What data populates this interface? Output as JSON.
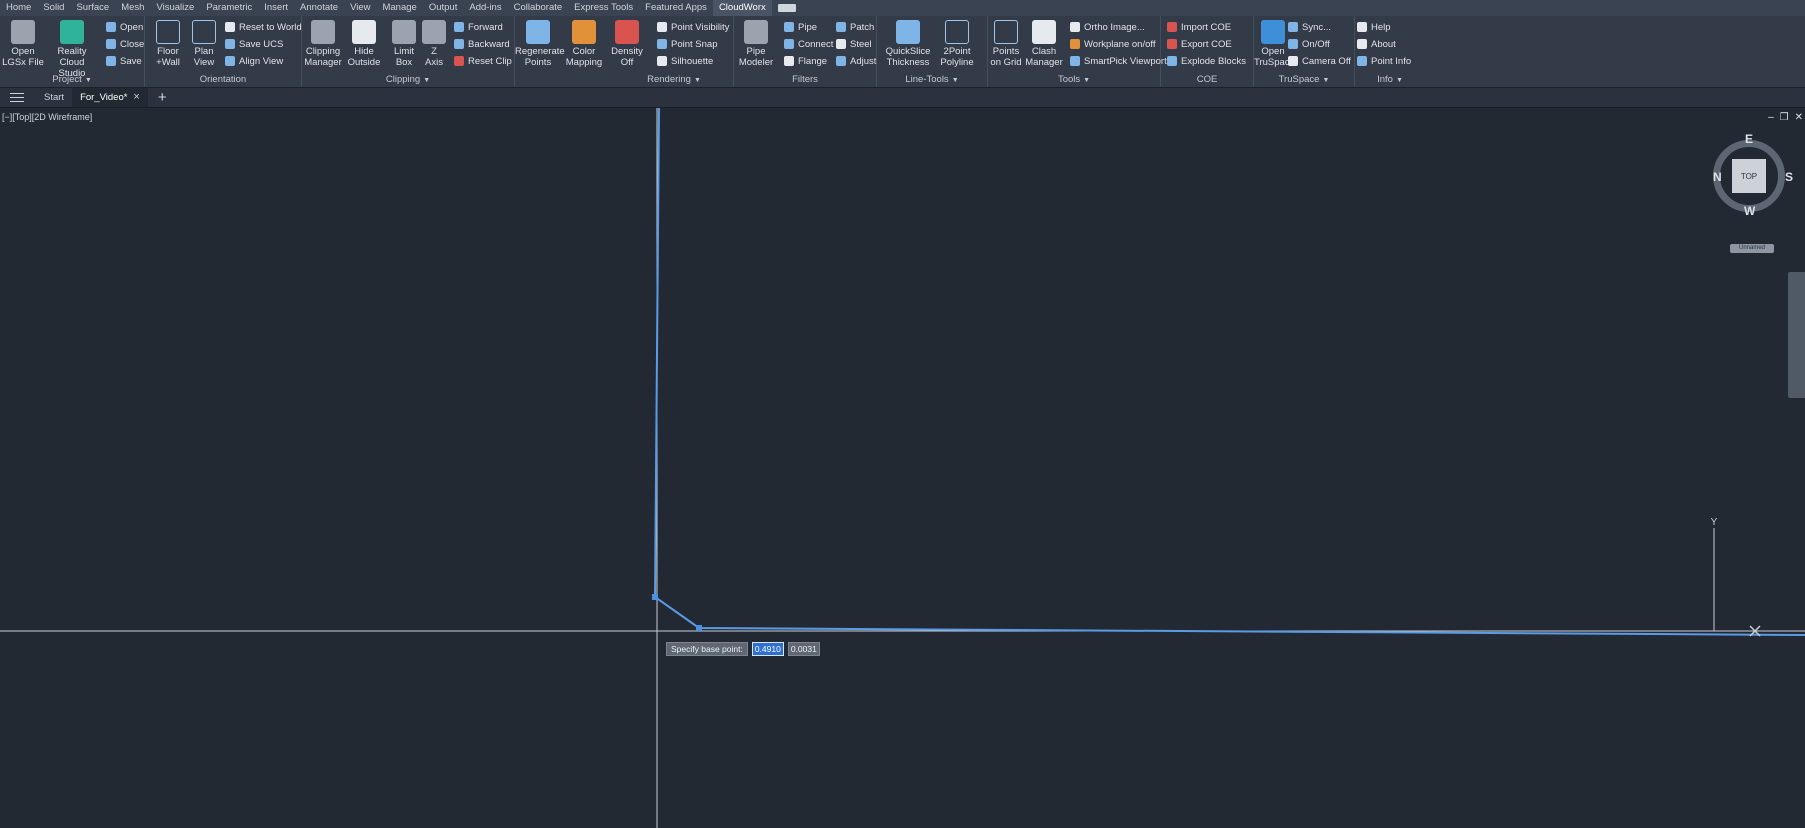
{
  "ribbon_tabs": [
    "Home",
    "Solid",
    "Surface",
    "Mesh",
    "Visualize",
    "Parametric",
    "Insert",
    "Annotate",
    "View",
    "Manage",
    "Output",
    "Add-ins",
    "Collaborate",
    "Express Tools",
    "Featured Apps",
    "CloudWorx"
  ],
  "active_tab": "CloudWorx",
  "panels": {
    "project": {
      "title": "Project",
      "open_lgsx": "Open\nLGSx File",
      "reality_cloud": "Reality Cloud\nStudio",
      "open": "Open",
      "close": "Close",
      "save": "Save"
    },
    "orientation": {
      "title": "Orientation",
      "floor_wall": "Floor\n+Wall",
      "plan_view": "Plan\nView",
      "reset_world": "Reset to World",
      "save_ucs": "Save UCS",
      "align_view": "Align View"
    },
    "clipping": {
      "title": "Clipping",
      "clip_manager": "Clipping\nManager",
      "hide_outside": "Hide\nOutside",
      "limit_box": "Limit\nBox",
      "z_axis": "Z\nAxis",
      "forward": "Forward",
      "backward": "Backward",
      "reset_clip": "Reset Clip"
    },
    "rendering": {
      "title": "Rendering",
      "regenerate": "Regenerate\nPoints",
      "color_mapping": "Color\nMapping",
      "density": "Density\nOff",
      "point_visibility": "Point Visibility",
      "point_snap": "Point Snap",
      "silhouette": "Silhouette"
    },
    "filters": {
      "title": "Filters",
      "pipe_modeler": "Pipe\nModeler",
      "pipe": "Pipe",
      "connect": "Connect",
      "flange": "Flange",
      "patch": "Patch",
      "steel": "Steel",
      "adjust": "Adjust"
    },
    "line_tools": {
      "title": "Line-Tools",
      "quickslice": "QuickSlice\nThickness",
      "twopoint": "2Point\nPolyline"
    },
    "tools": {
      "title": "Tools",
      "points_grid": "Points\non Grid",
      "clash_manager": "Clash\nManager",
      "ortho_image": "Ortho Image...",
      "workplane": "Workplane on/off",
      "smartpick": "SmartPick Viewport"
    },
    "coe": {
      "title": "COE",
      "import_coe": "Import COE",
      "export_coe": "Export COE",
      "explode_blocks": "Explode Blocks"
    },
    "truspace": {
      "title": "TruSpace",
      "open_truspace": "Open\nTruSpace",
      "sync": "Sync...",
      "on_off": "On/Off",
      "camera_off": "Camera Off"
    },
    "info": {
      "title": "Info",
      "help": "Help",
      "about": "About",
      "point_info": "Point Info"
    }
  },
  "doc_tabs": {
    "start": "Start",
    "active": "For_Video*"
  },
  "viewport": {
    "label": "[−][Top][2D Wireframe]"
  },
  "viewcube": {
    "face": "TOP",
    "north": "N",
    "south": "S",
    "east": "E",
    "west": "W",
    "badge": "Unnamed"
  },
  "ucs": {
    "y_label": "Y"
  },
  "command": {
    "prompt": "Specify base point:",
    "x_value": "0.4910",
    "y_value": "0.0031"
  },
  "colors": {
    "background": "#222933",
    "polyline": "#5b9be6",
    "accent": "#2d6fd3"
  }
}
